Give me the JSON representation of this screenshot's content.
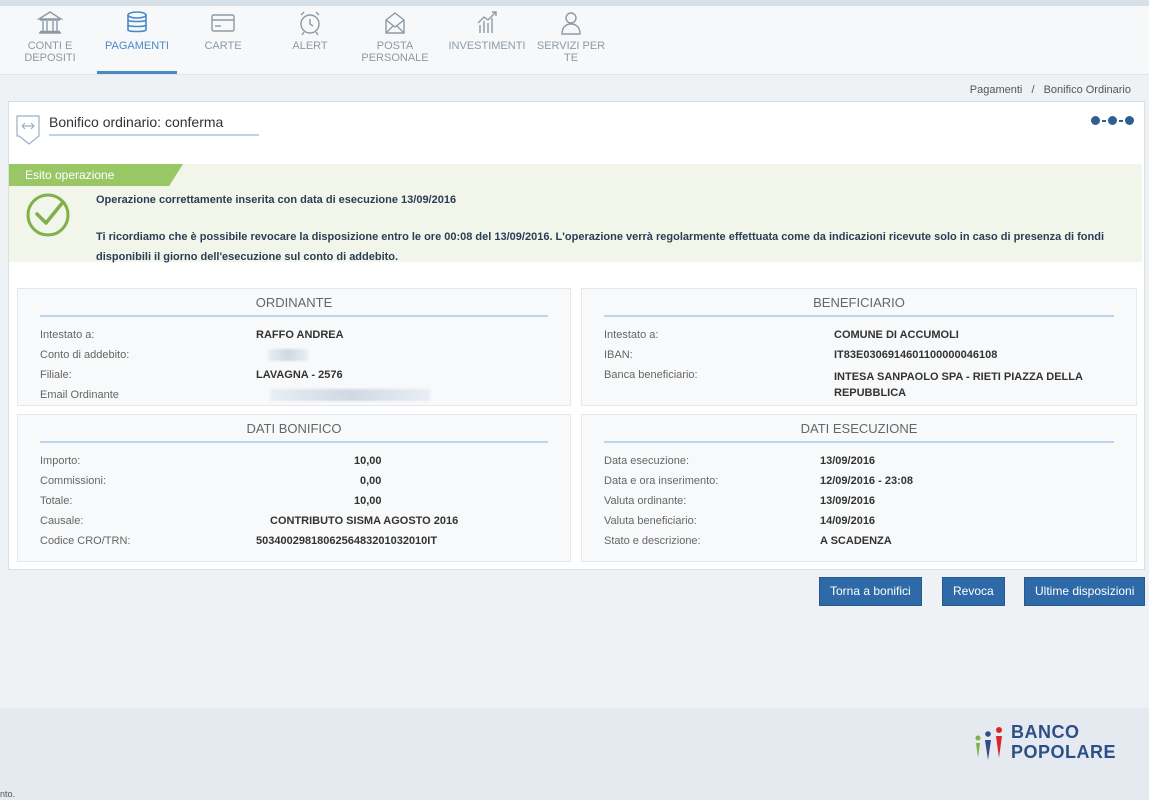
{
  "nav": {
    "items": [
      {
        "label": "CONTI E DEPOSITI",
        "icon": "bank-icon"
      },
      {
        "label": "PAGAMENTI",
        "icon": "coins-icon",
        "active": true
      },
      {
        "label": "CARTE",
        "icon": "card-icon"
      },
      {
        "label": "ALERT",
        "icon": "alarm-clock-icon"
      },
      {
        "label": "POSTA PERSONALE",
        "icon": "mail-icon"
      },
      {
        "label": "INVESTIMENTI",
        "icon": "chart-icon"
      },
      {
        "label": "SERVIZI PER TE",
        "icon": "person-icon"
      }
    ]
  },
  "breadcrumb": {
    "items": [
      "Pagamenti",
      "Bonifico Ordinario"
    ],
    "separator": "/"
  },
  "panel": {
    "title": "Bonifico ordinario: conferma"
  },
  "esito": {
    "tag": "Esito operazione",
    "title": "Operazione correttamente inserita con data di esecuzione 13/09/2016",
    "text": "Ti ricordiamo che è possibile revocare la disposizione entro le ore 00:08 del 13/09/2016. L'operazione verrà regolarmente effettuata come da indicazioni ricevute solo in caso di presenza di fondi disponibili il giorno dell'esecuzione sul conto di addebito."
  },
  "ordinante": {
    "title": "ORDINANTE",
    "rows": [
      {
        "label": "Intestato a:",
        "value": "RAFFO ANDREA"
      },
      {
        "label": "Conto di addebito:",
        "value": ""
      },
      {
        "label": "Filiale:",
        "value": "LAVAGNA - 2576"
      },
      {
        "label": "Email Ordinante",
        "value": ""
      }
    ]
  },
  "beneficiario": {
    "title": "BENEFICIARIO",
    "rows": [
      {
        "label": "Intestato a:",
        "value": "COMUNE DI ACCUMOLI"
      },
      {
        "label": "IBAN:",
        "value": "IT83E0306914601100000046108"
      },
      {
        "label": "Banca beneficiario:",
        "value": "INTESA SANPAOLO SPA - RIETI PIAZZA DELLA REPUBBLICA"
      }
    ]
  },
  "dati_bonifico": {
    "title": "DATI BONIFICO",
    "rows": [
      {
        "label": "Importo:",
        "value": "10,00"
      },
      {
        "label": "Commissioni:",
        "value": "0,00"
      },
      {
        "label": "Totale:",
        "value": "10,00"
      },
      {
        "label": "Causale:",
        "value": "CONTRIBUTO SISMA AGOSTO 2016"
      },
      {
        "label": "Codice CRO/TRN:",
        "value": "5034002981806256483201032010IT"
      }
    ]
  },
  "dati_esecuzione": {
    "title": "DATI ESECUZIONE",
    "rows": [
      {
        "label": "Data esecuzione:",
        "value": "13/09/2016"
      },
      {
        "label": "Data e ora inserimento:",
        "value": "12/09/2016 - 23:08"
      },
      {
        "label": "Valuta ordinante:",
        "value": "13/09/2016"
      },
      {
        "label": "Valuta beneficiario:",
        "value": "14/09/2016"
      },
      {
        "label": "Stato e descrizione:",
        "value": "A SCADENZA"
      }
    ]
  },
  "buttons": {
    "back": "Torna a bonifici",
    "revoke": "Revoca",
    "latest": "Ultime disposizioni"
  },
  "footer": {
    "logo_line1": "BANCO",
    "logo_line2": "POPOLARE",
    "note": "nto."
  },
  "colors": {
    "accent": "#2f6aa8",
    "success": "#7fb04a",
    "nav_active": "#4a88c7"
  }
}
